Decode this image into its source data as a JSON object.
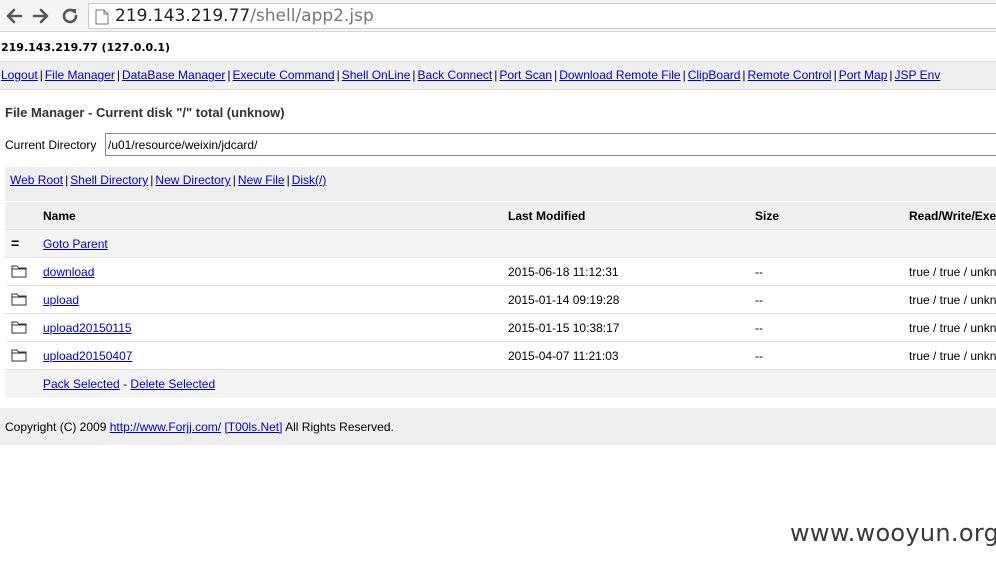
{
  "browser": {
    "url_host": "219.143.219.77",
    "url_path": "/shell/app2.jsp"
  },
  "host": {
    "title": "219.143.219.77 (127.0.0.1)"
  },
  "menu": {
    "items": [
      "Logout",
      "File Manager",
      "DataBase Manager",
      "Execute Command",
      "Shell OnLine",
      "Back Connect",
      "Port Scan",
      "Download Remote File",
      "ClipBoard",
      "Remote Control",
      "Port Map",
      "JSP Env"
    ],
    "separator": "|"
  },
  "file_manager": {
    "title": "File Manager - Current disk \"/\" total (unknow)",
    "current_dir_label": "Current Directory",
    "current_dir_value": "/u01/resource/weixin/jdcard/",
    "sub_nav": [
      "Web Root",
      "Shell Directory",
      "New Directory",
      "New File",
      "Disk(/)"
    ],
    "columns": {
      "name": "Name",
      "modified": "Last Modified",
      "size": "Size",
      "rwx": "Read/Write/Exe"
    },
    "parent_icon": "=",
    "parent_label": "Goto Parent",
    "rows": [
      {
        "name": "download",
        "modified": "2015-06-18 11:12:31",
        "size": "--",
        "rwx": "true / true / unknow"
      },
      {
        "name": "upload",
        "modified": "2015-01-14 09:19:28",
        "size": "--",
        "rwx": "true / true / unknow"
      },
      {
        "name": "upload20150115",
        "modified": "2015-01-15 10:38:17",
        "size": "--",
        "rwx": "true / true / unknow"
      },
      {
        "name": "upload20150407",
        "modified": "2015-04-07 11:21:03",
        "size": "--",
        "rwx": "true / true / unknow"
      }
    ],
    "actions": {
      "pack": "Pack Selected",
      "dash": "-",
      "delete": "Delete Selected"
    }
  },
  "footer": {
    "prefix": "Copyright (C) 2009",
    "link1": "http://www.Forjj.com/",
    "link2": "[T00ls.Net]",
    "suffix": "All Rights Reserved."
  },
  "watermark": "www.wooyun.org",
  "colors": {
    "link": "#0000cc",
    "menu_bg": "#efefef"
  },
  "icons": [
    "back-arrow-icon",
    "forward-arrow-icon",
    "reload-icon",
    "page-icon",
    "folder-icon"
  ]
}
